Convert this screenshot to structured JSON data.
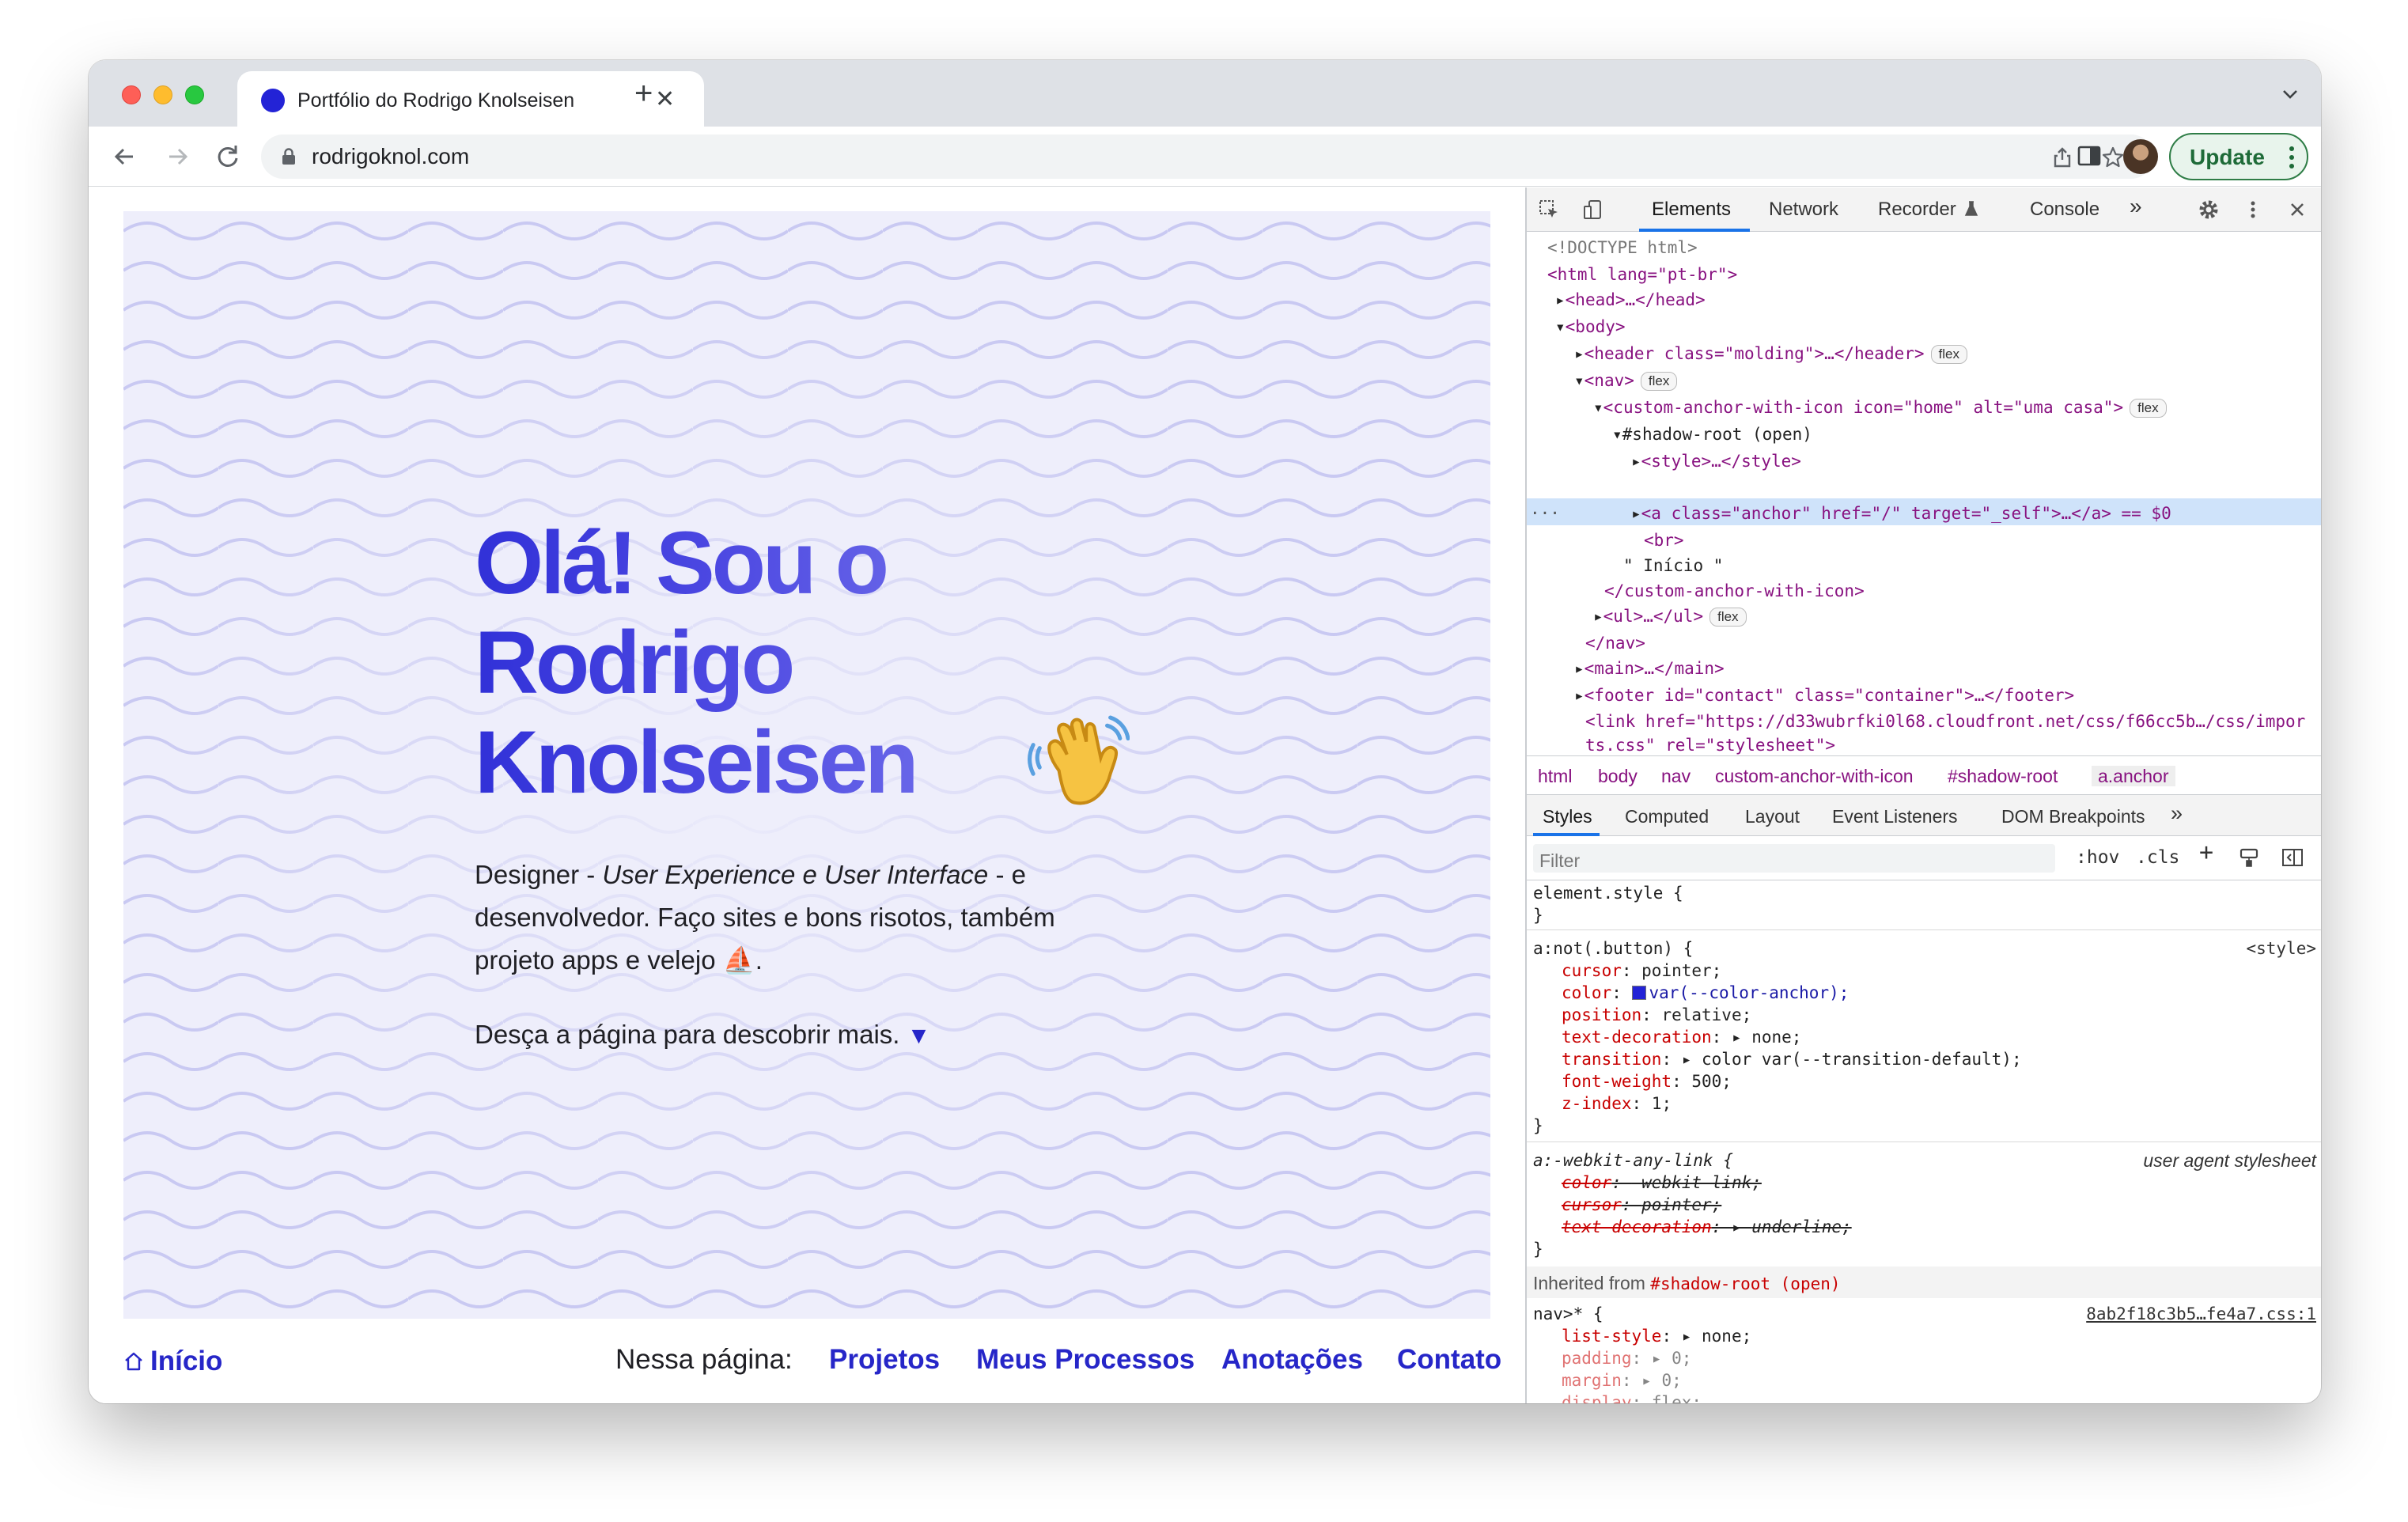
{
  "browser": {
    "tab_title": "Portfólio do Rodrigo Knolseisen",
    "url": "rodrigoknol.com",
    "update_label": "Update"
  },
  "page": {
    "hero_title": "Olá! Sou o Rodrigo Knolseisen",
    "hero_desc_1": "Designer - ",
    "hero_desc_em": "User Experience e User Interface",
    "hero_desc_2": " - e desenvolvedor. Faço sites e bons risotos, também projeto apps e velejo ⛵.",
    "hero_scroll": "Desça a página para descobrir mais.",
    "hero_scroll_arrow": "▼",
    "home_link": "Início",
    "nav_label": "Nessa página:",
    "nav_links": [
      "Projetos",
      "Meus Processos",
      "Anotações",
      "Contato"
    ]
  },
  "devtools": {
    "tabs": [
      "Elements",
      "Network",
      "Recorder",
      "Console"
    ],
    "dom": [
      "<!DOCTYPE html>",
      "<html lang=\"pt-br\">",
      "<head>…</head>",
      "<body>",
      "<header class=\"molding\">…</header>",
      "<nav>",
      "<custom-anchor-with-icon icon=\"home\" alt=\"uma casa\">",
      "#shadow-root (open)",
      "<style>…</style>",
      "<a class=\"anchor\" href=\"/\" target=\"_self\">…</a> == $0",
      "<br>",
      "\" Início \"",
      "</custom-anchor-with-icon>",
      "<ul>…</ul>",
      "</nav>",
      "<main>…</main>",
      "<footer id=\"contact\" class=\"container\">…</footer>",
      "<link href=\"https://d33wubrfki0l68.cloudfront.net/css/f66cc5b…/css/imports.css\" rel=\"stylesheet\">"
    ],
    "badge_flex": "flex",
    "ellipsis": "…",
    "breadcrumbs": [
      "html",
      "body",
      "nav",
      "custom-anchor-with-icon",
      "#shadow-root",
      "a.anchor"
    ],
    "sub_tabs": [
      "Styles",
      "Computed",
      "Layout",
      "Event Listeners",
      "DOM Breakpoints"
    ],
    "filter_placeholder": "Filter",
    "hov": ":hov",
    "cls": ".cls",
    "styles": {
      "element_style": "element.style {",
      "close_brace": "}",
      "rule1_selector": "a:not(.button) {",
      "rule1_source": "<style>",
      "rule1_props": [
        [
          "cursor",
          "pointer;"
        ],
        [
          "color",
          "var(--color-anchor);"
        ],
        [
          "position",
          "relative;"
        ],
        [
          "text-decoration",
          "none;"
        ],
        [
          "transition",
          "color var(--transition-default);"
        ],
        [
          "font-weight",
          "500;"
        ],
        [
          "z-index",
          "1;"
        ]
      ],
      "rule2_selector": "a:-webkit-any-link {",
      "rule2_source": "user agent stylesheet",
      "rule2_props": [
        [
          "color",
          "-webkit-link;"
        ],
        [
          "cursor",
          "pointer;"
        ],
        [
          "text-decoration",
          "underline;"
        ]
      ],
      "inherited_label": "Inherited from",
      "inherited_from": "#shadow-root (open)",
      "rule3_selector": "nav>* {",
      "rule3_source": "8ab2f18c3b5…fe4a7.css:1",
      "rule3_props": [
        [
          "list-style",
          "none;"
        ],
        [
          "padding",
          "0;"
        ],
        [
          "margin",
          "0;"
        ],
        [
          "display",
          "flex;"
        ]
      ]
    }
  },
  "colors": {
    "accent": "#2626c8",
    "hero_bg": "#eeeefb",
    "wave": "#c9c9f2",
    "update_green": "#1e6b38"
  }
}
